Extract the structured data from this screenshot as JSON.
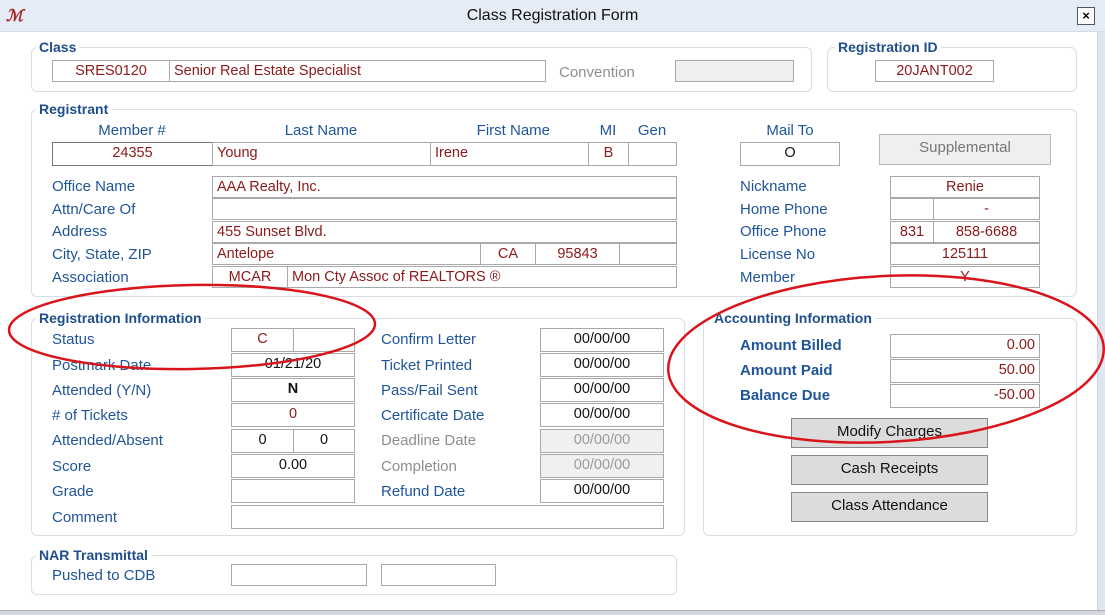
{
  "window": {
    "title": "Class Registration Form",
    "logo_icon": "app-logo-icon",
    "close_label": "×"
  },
  "class_group": {
    "label": "Class",
    "class_code": "SRES0120",
    "class_name": "Senior Real Estate Specialist",
    "convention_label": "Convention",
    "convention_value": ""
  },
  "registration_id_group": {
    "label": "Registration ID",
    "value": "20JANT002"
  },
  "registrant": {
    "label": "Registrant",
    "headers": {
      "member_no": "Member #",
      "last_name": "Last Name",
      "first_name": "First Name",
      "mi": "MI",
      "gen": "Gen",
      "mail_to": "Mail To"
    },
    "member_no": "24355",
    "last_name": "Young",
    "first_name": "Irene",
    "mi": "B",
    "gen": "",
    "mail_to": "O",
    "supplemental_button": "Supplemental",
    "labels": {
      "office_name": "Office Name",
      "attn": "Attn/Care Of",
      "address": "Address",
      "city_state_zip": "City, State, ZIP",
      "association": "Association",
      "nickname": "Nickname",
      "home_phone": "Home Phone",
      "office_phone": "Office Phone",
      "license_no": "License No",
      "member": "Member"
    },
    "office_name": "AAA Realty, Inc.",
    "attn": "",
    "address": "455 Sunset Blvd.",
    "city": "Antelope",
    "state": "CA",
    "zip": "95843",
    "zip_ext": "",
    "association_code": "MCAR",
    "association_name": "Mon Cty Assoc of REALTORS ®",
    "nickname": "Renie",
    "home_phone_area": "",
    "home_phone_number": "-",
    "office_phone_area": "831",
    "office_phone_number": "858-6688",
    "license_no": "125111",
    "member": "Y"
  },
  "registration_info": {
    "label": "Registration Information",
    "labels": {
      "status": "Status",
      "postmark_date": "Postmark Date",
      "attended": "Attended (Y/N)",
      "tickets": "# of Tickets",
      "attended_absent": "Attended/Absent",
      "score": "Score",
      "grade": "Grade",
      "comment": "Comment",
      "confirm_letter": "Confirm Letter",
      "ticket_printed": "Ticket Printed",
      "pass_fail_sent": "Pass/Fail Sent",
      "certificate_date": "Certificate Date",
      "deadline_date": "Deadline Date",
      "completion": "Completion",
      "refund_date": "Refund Date"
    },
    "status": "C",
    "status_extra": "",
    "postmark_date": "01/21/20",
    "attended": "N",
    "tickets": "0",
    "attended_count": "0",
    "absent_count": "0",
    "score": "0.00",
    "grade": "",
    "comment": "",
    "confirm_letter": "00/00/00",
    "ticket_printed": "00/00/00",
    "pass_fail_sent": "00/00/00",
    "certificate_date": "00/00/00",
    "deadline_date": "00/00/00",
    "completion": "00/00/00",
    "refund_date": "00/00/00"
  },
  "accounting": {
    "label": "Accounting Information",
    "labels": {
      "billed": "Amount Billed",
      "paid": "Amount Paid",
      "balance": "Balance Due"
    },
    "billed": "0.00",
    "paid": "50.00",
    "balance": "-50.00",
    "buttons": {
      "modify_charges": "Modify Charges",
      "cash_receipts": "Cash Receipts",
      "class_attendance": "Class Attendance"
    }
  },
  "nar": {
    "label": "NAR Transmittal",
    "pushed_label": "Pushed to CDB",
    "pushed_value1": "",
    "pushed_value2": ""
  },
  "annotations": {
    "color": "#d9141b"
  }
}
